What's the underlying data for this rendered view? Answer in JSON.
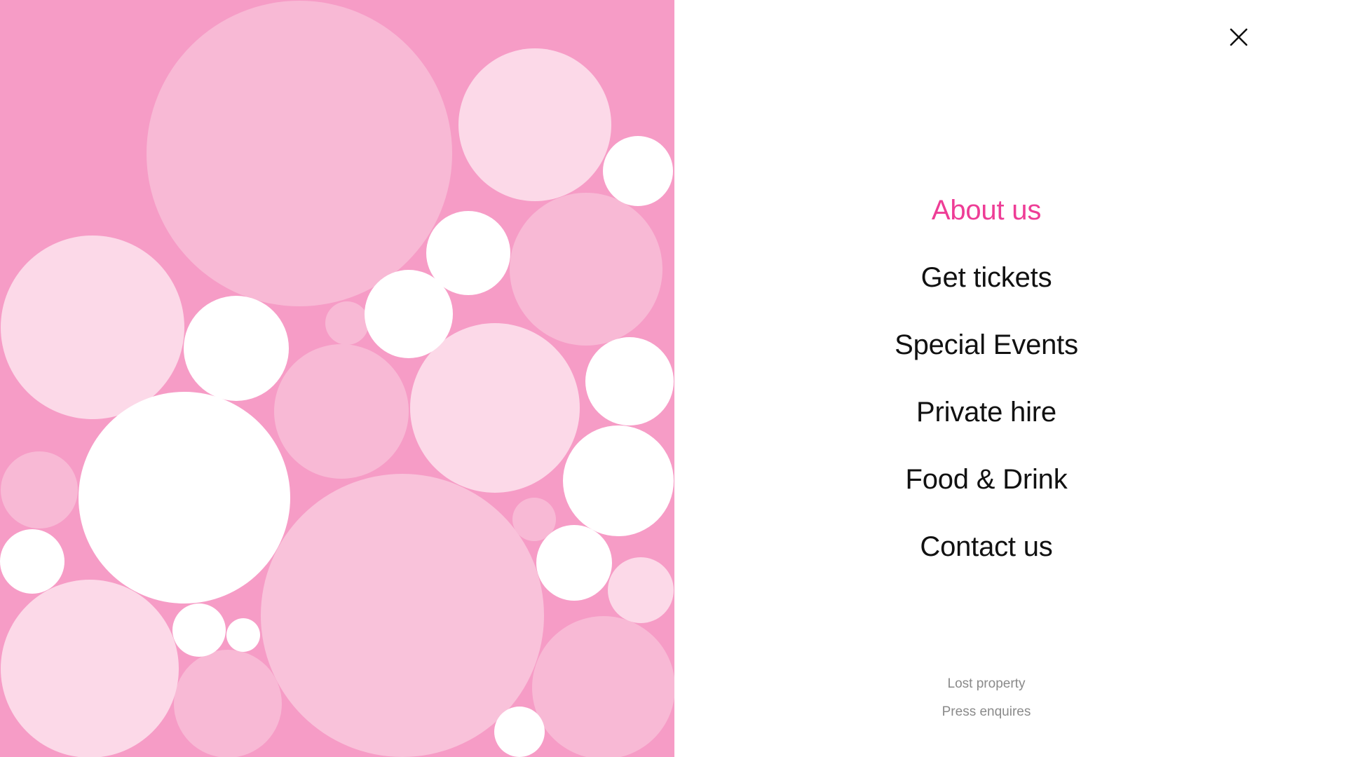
{
  "colors": {
    "panel_background": "#f69cc6",
    "bubble_light": "#fcd9e8",
    "bubble_medium": "#f8b9d5",
    "bubble_white": "#ffffff",
    "accent": "#ee3d96",
    "nav_text": "#111111",
    "footer_text": "#8a8a8a"
  },
  "menu": {
    "close_icon": "close-icon",
    "items": [
      {
        "label": "About us",
        "active": true
      },
      {
        "label": "Get tickets",
        "active": false
      },
      {
        "label": "Special Events",
        "active": false
      },
      {
        "label": "Private hire",
        "active": false
      },
      {
        "label": "Food & Drink",
        "active": false
      },
      {
        "label": "Contact us",
        "active": false
      }
    ],
    "footer_links": [
      {
        "label": "Lost property"
      },
      {
        "label": "Press enquires"
      }
    ]
  }
}
